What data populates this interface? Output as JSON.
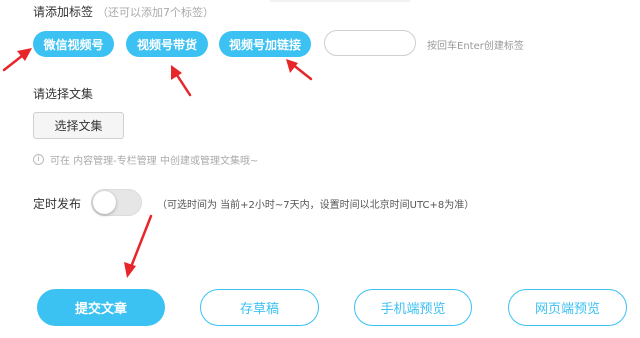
{
  "tags": {
    "title": "请添加标签",
    "hint": "（还可以添加7个标签）",
    "items": [
      "微信视频号",
      "视频号带货",
      "视频号加链接"
    ],
    "input_placeholder": "",
    "enter_hint": "按回车Enter创建标签"
  },
  "collection": {
    "title": "请选择文集",
    "choose_label": "选择文集",
    "info_text": "可在 内容管理-专栏管理 中创建或管理文集哦~"
  },
  "schedule": {
    "label": "定时发布",
    "enabled": false,
    "hint": "（可选时间为 当前+2小时~7天内，设置时间以北京时间UTC+8为准）"
  },
  "actions": {
    "submit": "提交文章",
    "draft": "存草稿",
    "mobile_preview": "手机端预览",
    "web_preview": "网页端预览"
  },
  "colors": {
    "accent": "#3cc1f3",
    "annotation_arrow": "#e8262a"
  }
}
